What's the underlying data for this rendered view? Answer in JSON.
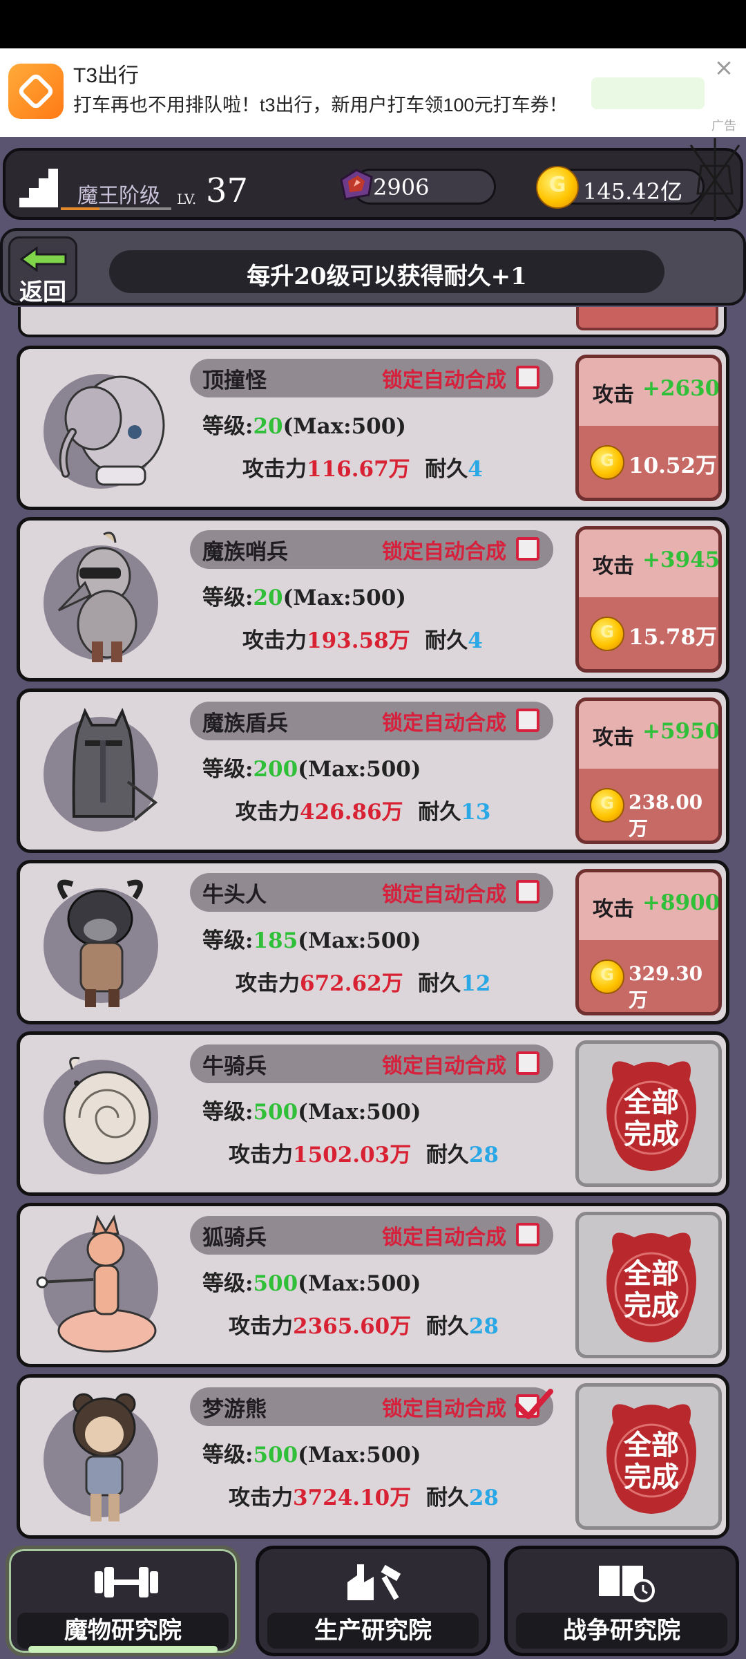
{
  "ad": {
    "title": "T3出行",
    "text": "打车再也不用排队啦！t3出行，新用户打车领100元打车券！",
    "tag": "广告",
    "close": "×"
  },
  "topbar": {
    "rank_label": "魔王阶级",
    "lv_prefix": "LV.",
    "lv_value": "37",
    "gems": "2906",
    "gold": "145.42亿"
  },
  "banner": {
    "back_label": "返回",
    "text": "每升20级可以获得耐久+1"
  },
  "labels": {
    "lock": "锁定自动合成",
    "level_prefix": "等级:",
    "attack_prefix": "攻击力",
    "durability_prefix": "耐久",
    "upgrade_label": "攻击",
    "done_line1": "全部",
    "done_line2": "完成"
  },
  "monsters": [
    {
      "name": "顶撞怪",
      "level": "20",
      "max": "(Max:500)",
      "attack": "116.67万",
      "durability": "4",
      "upgrade_attack": "+2630",
      "cost": "10.52万",
      "locked": false,
      "done": false
    },
    {
      "name": "魔族哨兵",
      "level": "20",
      "max": "(Max:500)",
      "attack": "193.58万",
      "durability": "4",
      "upgrade_attack": "+3945",
      "cost": "15.78万",
      "locked": false,
      "done": false
    },
    {
      "name": "魔族盾兵",
      "level": "200",
      "max": "(Max:500)",
      "attack": "426.86万",
      "durability": "13",
      "upgrade_attack": "+5950",
      "cost": "238.00万",
      "locked": false,
      "done": false
    },
    {
      "name": "牛头人",
      "level": "185",
      "max": "(Max:500)",
      "attack": "672.62万",
      "durability": "12",
      "upgrade_attack": "+8900",
      "cost": "329.30万",
      "locked": false,
      "done": false
    },
    {
      "name": "牛骑兵",
      "level": "500",
      "max": "(Max:500)",
      "attack": "1502.03万",
      "durability": "28",
      "locked": false,
      "done": true
    },
    {
      "name": "狐骑兵",
      "level": "500",
      "max": "(Max:500)",
      "attack": "2365.60万",
      "durability": "28",
      "locked": false,
      "done": true
    },
    {
      "name": "梦游熊",
      "level": "500",
      "max": "(Max:500)",
      "attack": "3724.10万",
      "durability": "28",
      "locked": true,
      "done": true
    }
  ],
  "tabs": [
    {
      "label": "魔物研究院",
      "icon": "dumbbell-icon",
      "active": true
    },
    {
      "label": "生产研究院",
      "icon": "factory-hammer-icon",
      "active": false
    },
    {
      "label": "战争研究院",
      "icon": "book-clock-icon",
      "active": false
    }
  ],
  "colors": {
    "accent_red": "#d82233",
    "accent_green": "#2fbf38",
    "accent_blue": "#2aa8e6",
    "upgrade_bg": "#c76a66"
  }
}
